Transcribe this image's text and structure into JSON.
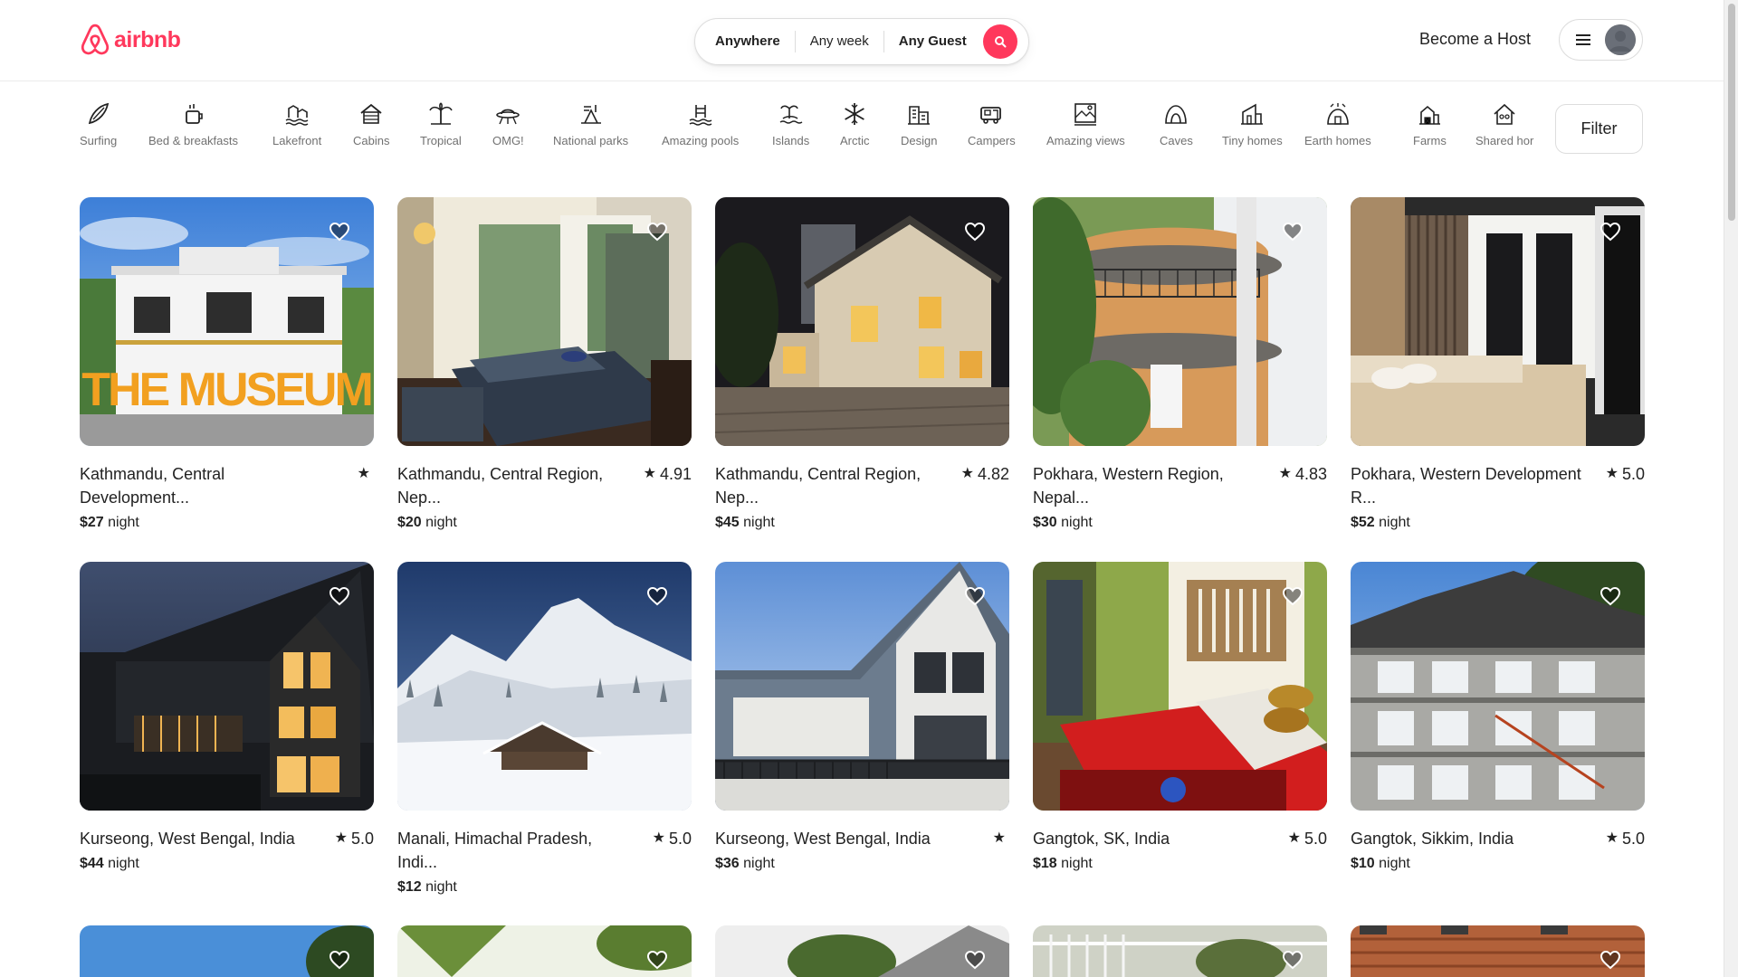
{
  "brand": {
    "name": "airbnb",
    "color": "#FF385C"
  },
  "search": {
    "where": "Anywhere",
    "when": "Any week",
    "who": "Any Guest",
    "button_icon": "search-icon"
  },
  "header": {
    "host_link": "Become a Host",
    "menu_icon": "hamburger-icon",
    "avatar_icon": "user-avatar"
  },
  "categories": [
    {
      "label": "Surfing",
      "icon": "surfboard-icon"
    },
    {
      "label": "Bed & breakfasts",
      "icon": "coffee-icon"
    },
    {
      "label": "Lakefront",
      "icon": "lake-icon"
    },
    {
      "label": "Cabins",
      "icon": "cabin-icon"
    },
    {
      "label": "Tropical",
      "icon": "palm-icon"
    },
    {
      "label": "OMG!",
      "icon": "ufo-icon"
    },
    {
      "label": "National parks",
      "icon": "park-icon"
    },
    {
      "label": "Amazing pools",
      "icon": "pool-icon"
    },
    {
      "label": "Islands",
      "icon": "island-icon"
    },
    {
      "label": "Arctic",
      "icon": "snowflake-icon"
    },
    {
      "label": "Design",
      "icon": "building-icon"
    },
    {
      "label": "Campers",
      "icon": "camper-icon"
    },
    {
      "label": "Amazing views",
      "icon": "view-icon"
    },
    {
      "label": "Caves",
      "icon": "cave-icon"
    },
    {
      "label": "Tiny homes",
      "icon": "tiny-home-icon"
    },
    {
      "label": "Earth homes",
      "icon": "earth-home-icon"
    },
    {
      "label": "Farms",
      "icon": "farm-icon"
    },
    {
      "label": "Shared hor",
      "icon": "shared-home-icon"
    }
  ],
  "filter": {
    "label": "Filter"
  },
  "listings": [
    {
      "location": "Kathmandu, Central Development...",
      "rating": "",
      "price": "$27",
      "unit": "night"
    },
    {
      "location": "Kathmandu, Central Region, Nep...",
      "rating": "4.91",
      "price": "$20",
      "unit": "night"
    },
    {
      "location": "Kathmandu, Central Region, Nep...",
      "rating": "4.82",
      "price": "$45",
      "unit": "night"
    },
    {
      "location": "Pokhara, Western Region, Nepal...",
      "rating": "4.83",
      "price": "$30",
      "unit": "night"
    },
    {
      "location": "Pokhara, Western Development R...",
      "rating": "5.0",
      "price": "$52",
      "unit": "night"
    },
    {
      "location": "Kurseong, West Bengal, India",
      "rating": "5.0",
      "price": "$44",
      "unit": "night"
    },
    {
      "location": "Manali, Himachal Pradesh, Indi...",
      "rating": "5.0",
      "price": "$12",
      "unit": "night"
    },
    {
      "location": "Kurseong, West Bengal, India",
      "rating": "",
      "price": "$36",
      "unit": "night"
    },
    {
      "location": "Gangtok, SK, India",
      "rating": "5.0",
      "price": "$18",
      "unit": "night"
    },
    {
      "location": "Gangtok, Sikkim, India",
      "rating": "5.0",
      "price": "$10",
      "unit": "night"
    }
  ],
  "image_overlay": {
    "museum_sign": "THE MUSEUM"
  }
}
